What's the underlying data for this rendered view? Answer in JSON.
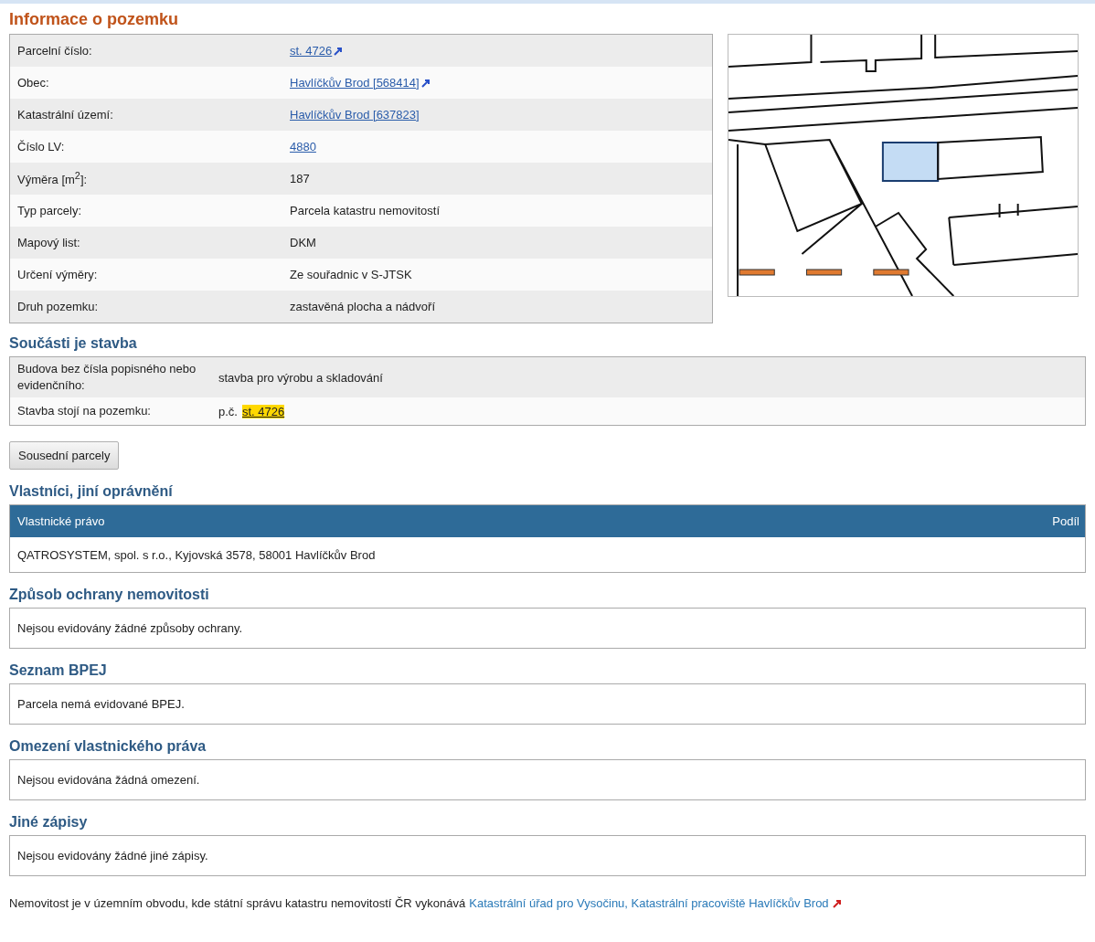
{
  "title": "Informace o pozemku",
  "info_rows": [
    {
      "label": "Parcelní číslo:",
      "value": "st. 4726",
      "kind": "link",
      "external": true
    },
    {
      "label": "Obec:",
      "value": "Havlíčkův Brod [568414]",
      "kind": "link",
      "external": true
    },
    {
      "label": "Katastrální území:",
      "value": "Havlíčkův Brod [637823]",
      "kind": "link",
      "external": false
    },
    {
      "label": "Číslo LV:",
      "value": "4880",
      "kind": "link",
      "external": false
    },
    {
      "label": "Výměra [m$^{2}$]:",
      "value": "187",
      "kind": "text",
      "external": false
    },
    {
      "label": "Typ parcely:",
      "value": "Parcela katastru nemovitostí",
      "kind": "text",
      "external": false
    },
    {
      "label": "Mapový list:",
      "value": "DKM",
      "kind": "text",
      "external": false
    },
    {
      "label": "Určení výměry:",
      "value": "Ze souřadnic v S-JTSK",
      "kind": "text",
      "external": false
    },
    {
      "label": "Druh pozemku:",
      "value": "zastavěná plocha a nádvoří",
      "kind": "text",
      "external": false
    }
  ],
  "building": {
    "title": "Součásti je stavba",
    "rows": [
      {
        "label": "Budova bez čísla popisného nebo evidenčního:",
        "kind": "text",
        "value": "stavba pro výrobu a skladování"
      },
      {
        "label": "Stavba stojí na pozemku:",
        "kind": "highlight_link",
        "prefix": "p.č.",
        "value": "st. 4726"
      }
    ]
  },
  "neighbours_button": "Sousední parcely",
  "owners": {
    "title": "Vlastníci, jiní oprávnění",
    "columns": [
      "Vlastnické právo",
      "Podíl"
    ],
    "rows": [
      {
        "owner": "QATROSYSTEM, spol. s r.o., Kyjovská 3578, 58001 Havlíčkův Brod"
      }
    ]
  },
  "sections": [
    {
      "title": "Způsob ochrany nemovitosti",
      "text": "Nejsou evidovány žádné způsoby ochrany."
    },
    {
      "title": "Seznam BPEJ",
      "text": "Parcela nemá evidované BPEJ."
    },
    {
      "title": "Omezení vlastnického práva",
      "text": "Nejsou evidována žádná omezení."
    },
    {
      "title": "Jiné zápisy",
      "text": "Nejsou evidovány žádné jiné zápisy."
    }
  ],
  "footer": {
    "text": "Nemovitost je v územním obvodu, kde státní správu katastru nemovitostí ČR vykonává",
    "link": "Katastrální úřad pro Vysočinu, Katastrální pracoviště Havlíčkův Brod",
    "external": true
  }
}
